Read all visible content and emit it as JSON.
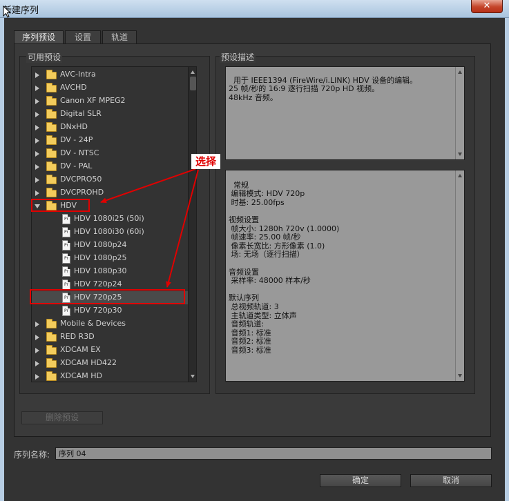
{
  "window": {
    "title": "新建序列",
    "close_label": "✕"
  },
  "tabs": [
    {
      "label": "序列预设"
    },
    {
      "label": "设置"
    },
    {
      "label": "轨道"
    }
  ],
  "presets": {
    "title": "可用预设",
    "tree": [
      {
        "label": "AVC-Intra"
      },
      {
        "label": "AVCHD"
      },
      {
        "label": "Canon XF MPEG2"
      },
      {
        "label": "Digital SLR"
      },
      {
        "label": "DNxHD"
      },
      {
        "label": "DV - 24P"
      },
      {
        "label": "DV - NTSC"
      },
      {
        "label": "DV - PAL"
      },
      {
        "label": "DVCPRO50"
      },
      {
        "label": "DVCPROHD"
      },
      {
        "label": "HDV"
      },
      {
        "label": "HDV 1080i25 (50i)"
      },
      {
        "label": "HDV 1080i30 (60i)"
      },
      {
        "label": "HDV 1080p24"
      },
      {
        "label": "HDV 1080p25"
      },
      {
        "label": "HDV 1080p30"
      },
      {
        "label": "HDV 720p24"
      },
      {
        "label": "HDV 720p25"
      },
      {
        "label": "HDV 720p30"
      },
      {
        "label": "Mobile & Devices"
      },
      {
        "label": "RED R3D"
      },
      {
        "label": "XDCAM EX"
      },
      {
        "label": "XDCAM HD422"
      },
      {
        "label": "XDCAM HD"
      }
    ],
    "file_icon_text": "Pr",
    "delete_label": "删除预设"
  },
  "description": {
    "title": "预设描述",
    "summary": "用于 IEEE1394 (FireWire/i.LINK) HDV 设备的编辑。\n25 帧/秒的 16:9 逐行扫描 720p HD 视频。\n48kHz 音频。",
    "details": "常规\n 编辑模式: HDV 720p\n 时基: 25.00fps\n\n视频设置\n 帧大小: 1280h 720v (1.0000)\n 帧速率: 25.00 帧/秒\n 像素长宽比: 方形像素 (1.0)\n 场: 无场（逐行扫描）\n\n音频设置\n 采样率: 48000 样本/秒\n\n默认序列\n 总视频轨道: 3\n 主轨道类型: 立体声\n 音频轨道:\n 音频1: 标准\n 音频2: 标准\n 音频3: 标准"
  },
  "annotation": {
    "label": "选择",
    "color": "#e00000"
  },
  "sequence_name": {
    "label": "序列名称:",
    "value": "序列 04"
  },
  "buttons": {
    "ok": "确定",
    "cancel": "取消"
  }
}
